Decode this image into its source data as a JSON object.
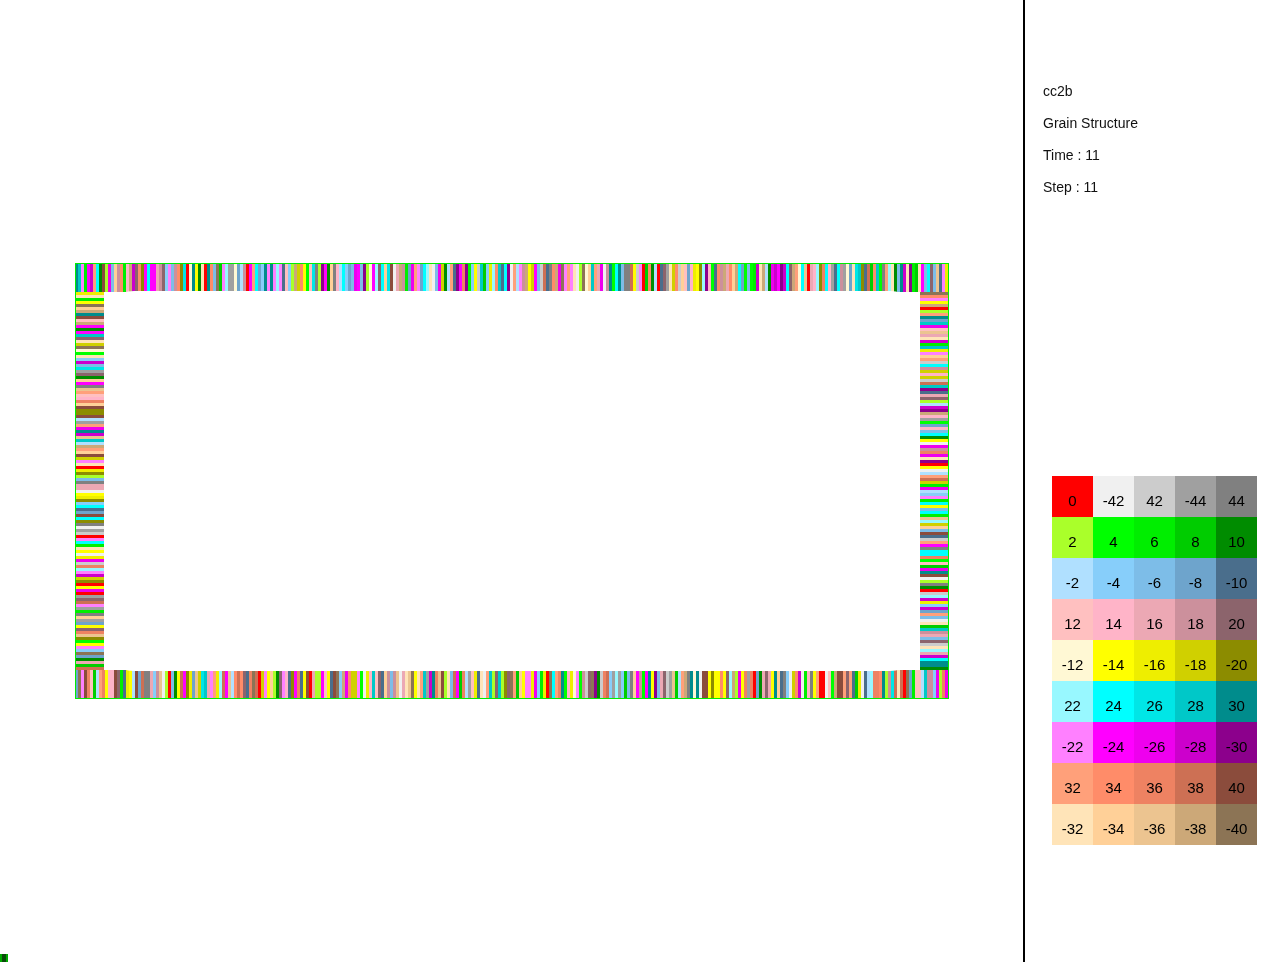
{
  "info": {
    "case": "cc2b",
    "view": "Grain Structure",
    "time": "Time : 11",
    "step": "Step : 11"
  },
  "legend": [
    [
      {
        "label": "0",
        "color": "#ff0000"
      },
      {
        "label": "-42",
        "color": "#f0f0f0"
      },
      {
        "label": "42",
        "color": "#cccccc"
      },
      {
        "label": "-44",
        "color": "#a0a0a0"
      },
      {
        "label": "44",
        "color": "#808080"
      }
    ],
    [
      {
        "label": "2",
        "color": "#aaff2a"
      },
      {
        "label": "4",
        "color": "#00ff00"
      },
      {
        "label": "6",
        "color": "#00ee00"
      },
      {
        "label": "8",
        "color": "#00cc00"
      },
      {
        "label": "10",
        "color": "#008c00"
      }
    ],
    [
      {
        "label": "-2",
        "color": "#b0e0ff"
      },
      {
        "label": "-4",
        "color": "#87cefa"
      },
      {
        "label": "-6",
        "color": "#7dbde8"
      },
      {
        "label": "-8",
        "color": "#6ea4cc"
      },
      {
        "label": "-10",
        "color": "#4a6e8c"
      }
    ],
    [
      {
        "label": "12",
        "color": "#ffc0c0"
      },
      {
        "label": "14",
        "color": "#ffb4c8"
      },
      {
        "label": "16",
        "color": "#eca8b4"
      },
      {
        "label": "18",
        "color": "#cc909c"
      },
      {
        "label": "20",
        "color": "#8c646c"
      }
    ],
    [
      {
        "label": "-12",
        "color": "#fff8d4"
      },
      {
        "label": "-14",
        "color": "#ffff00"
      },
      {
        "label": "-16",
        "color": "#eeee00"
      },
      {
        "label": "-18",
        "color": "#d0d000"
      },
      {
        "label": "-20",
        "color": "#8c8c00"
      }
    ],
    [
      {
        "label": "22",
        "color": "#98f8ff"
      },
      {
        "label": "24",
        "color": "#00ffff"
      },
      {
        "label": "26",
        "color": "#00e6e6"
      },
      {
        "label": "28",
        "color": "#00c8c8"
      },
      {
        "label": "30",
        "color": "#008c8c"
      }
    ],
    [
      {
        "label": "-22",
        "color": "#ff80ff"
      },
      {
        "label": "-24",
        "color": "#ff00ff"
      },
      {
        "label": "-26",
        "color": "#ee00ee"
      },
      {
        "label": "-28",
        "color": "#cc00cc"
      },
      {
        "label": "-30",
        "color": "#8c008c"
      }
    ],
    [
      {
        "label": "32",
        "color": "#ffa07a"
      },
      {
        "label": "34",
        "color": "#ff8c69"
      },
      {
        "label": "36",
        "color": "#ee8262"
      },
      {
        "label": "38",
        "color": "#cd7054"
      },
      {
        "label": "40",
        "color": "#8b4c3c"
      }
    ],
    [
      {
        "label": "-32",
        "color": "#ffe4b8"
      },
      {
        "label": "-34",
        "color": "#ffd098"
      },
      {
        "label": "-36",
        "color": "#ecc490"
      },
      {
        "label": "-38",
        "color": "#cca878"
      },
      {
        "label": "-40",
        "color": "#8c7455"
      }
    ]
  ]
}
